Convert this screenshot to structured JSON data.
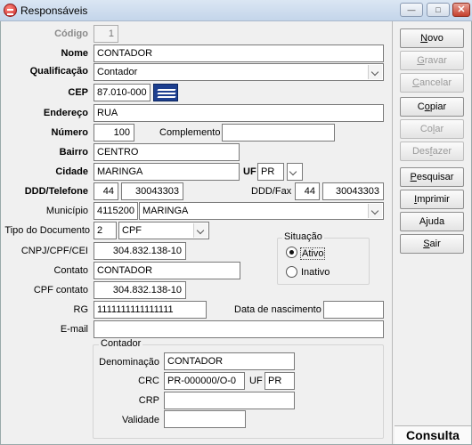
{
  "window": {
    "title": "Responsáveis",
    "min": "—",
    "max": "□",
    "close": "✕"
  },
  "fields": {
    "codigo": {
      "label": "Código",
      "value": "1"
    },
    "nome": {
      "label": "Nome",
      "value": "CONTADOR"
    },
    "qualificacao": {
      "label": "Qualificação",
      "value": "Contador"
    },
    "cep": {
      "label": "CEP",
      "value": "87.010-000"
    },
    "endereco": {
      "label": "Endereço",
      "value": "RUA"
    },
    "numero": {
      "label": "Número",
      "value": "100"
    },
    "complemento": {
      "label": "Complemento",
      "value": ""
    },
    "bairro": {
      "label": "Bairro",
      "value": "CENTRO"
    },
    "cidade": {
      "label": "Cidade",
      "value": "MARINGA"
    },
    "uf": {
      "label": "UF",
      "value": "PR"
    },
    "ddd_telefone": {
      "label": "DDD/Telefone",
      "ddd": "44",
      "value": "30043303"
    },
    "ddd_fax": {
      "label": "DDD/Fax",
      "ddd": "44",
      "value": "30043303"
    },
    "municipio": {
      "label": "Município",
      "code": "4115200",
      "value": "MARINGA"
    },
    "tipo_documento": {
      "label": "Tipo do Documento",
      "code": "2",
      "value": "CPF"
    },
    "cnpj": {
      "label": "CNPJ/CPF/CEI",
      "value": "304.832.138-10"
    },
    "contato": {
      "label": "Contato",
      "value": "CONTADOR"
    },
    "cpf_contato": {
      "label": "CPF contato",
      "value": "304.832.138-10"
    },
    "rg": {
      "label": "RG",
      "value": "1111111111111111"
    },
    "data_nascimento": {
      "label": "Data de nascimento",
      "value": ""
    },
    "email": {
      "label": "E-mail",
      "value": ""
    }
  },
  "situacao": {
    "title": "Situação",
    "options": [
      "Ativo",
      "Inativo"
    ],
    "selected": "Ativo"
  },
  "contador": {
    "title": "Contador",
    "denominacao": {
      "label": "Denominação",
      "value": "CONTADOR"
    },
    "crc": {
      "label": "CRC",
      "value": "PR-000000/O-0"
    },
    "uf": {
      "label": "UF",
      "value": "PR"
    },
    "crp": {
      "label": "CRP",
      "value": ""
    },
    "validade": {
      "label": "Validade",
      "value": ""
    }
  },
  "buttons": {
    "novo": {
      "u": "N",
      "rest": "ovo",
      "enabled": true
    },
    "gravar": {
      "u": "G",
      "rest": "ravar",
      "enabled": false
    },
    "cancelar": {
      "u": "C",
      "rest": "ancelar",
      "enabled": false
    },
    "copiar": {
      "pre": "C",
      "u": "o",
      "rest": "piar",
      "enabled": true
    },
    "colar": {
      "pre": "Co",
      "u": "l",
      "rest": "ar",
      "enabled": false
    },
    "desfazer": {
      "pre": "Des",
      "u": "f",
      "rest": "azer",
      "enabled": false
    },
    "pesquisar": {
      "u": "P",
      "rest": "esquisar",
      "enabled": true
    },
    "imprimir": {
      "u": "I",
      "rest": "mprimir",
      "enabled": true
    },
    "ajuda": {
      "pre": "A",
      "u": "j",
      "rest": "uda",
      "enabled": true
    },
    "sair": {
      "u": "S",
      "rest": "air",
      "enabled": true
    }
  },
  "status": {
    "mode": "Consulta"
  }
}
